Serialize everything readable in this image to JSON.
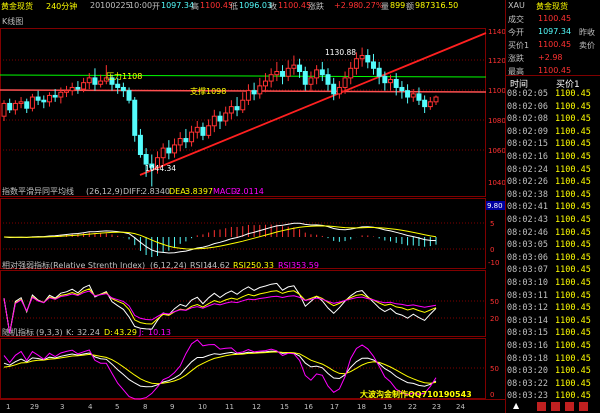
{
  "header": {
    "title": "黄金现货",
    "period": "240分钟",
    "date": "20100225",
    "time": "10:00",
    "open_label": "开",
    "open": "1097.34",
    "high_label": "高",
    "high": "1100.45",
    "low_label": "低",
    "low": "1096.03",
    "close_label": "收",
    "close": "1100.45",
    "change_label": "涨跌",
    "change": "+2.98",
    "pct": "0.27%",
    "vol_label": "量",
    "vol": "899",
    "amt_label": "额",
    "amt": "987316.50"
  },
  "main_chart": {
    "label": "K线图",
    "support_label": "支撑1098",
    "pressure_label": "压力1108",
    "high_note": "1130.88",
    "low_note": "1044.34",
    "y_ticks": [
      "1140",
      "1120",
      "1100",
      "1080",
      "1060",
      "1040"
    ]
  },
  "macd": {
    "name": "指数平滑异同平均线",
    "params": "(26,12,9)",
    "diff_label": "DIFF:",
    "diff": "2.8340",
    "dea_label": "DEA:",
    "dea": "3.8397",
    "macd_label": "MACD:",
    "macd": "-2.0114",
    "y_ticks": [
      "9.80",
      "5",
      "0",
      "-10"
    ]
  },
  "rsi": {
    "name": "相对强弱指标(Relative Strenth Index)",
    "params": "(6,12,24)",
    "rsi1_label": "RSI1:",
    "rsi1": "44.62",
    "rsi2_label": "RSI2:",
    "rsi2": "50.33",
    "rsi3_label": "RSI3:",
    "rsi3": "53.59",
    "y_ticks": [
      "50",
      "20"
    ]
  },
  "kdj": {
    "name": "随机指标",
    "params": "(9,3,3)",
    "k_label": "K:",
    "k": "32.24",
    "d_label": "D:",
    "d": "43.29",
    "j_label": "J:",
    "j": "10.13",
    "watermark": "大波沟金制作QQ710190543",
    "y_ticks": [
      "50",
      "0"
    ]
  },
  "x_axis": [
    "1",
    "29",
    "3",
    "4",
    "5",
    "8",
    "9",
    "10",
    "11",
    "12",
    "15",
    "16",
    "17",
    "18",
    "19",
    "22",
    "23",
    "24"
  ],
  "right_panel": {
    "symbol": "XAU",
    "name": "黄金现货",
    "quotes": [
      {
        "label": "成交",
        "value": "1100.45",
        "label2": "",
        "value2": ""
      },
      {
        "label": "今开",
        "value": "1097.34",
        "label2": "昨收",
        "value2": ""
      },
      {
        "label": "买价1",
        "value": "1100.45",
        "label2": "卖价",
        "value2": ""
      },
      {
        "label": "涨跌",
        "value": "+2.98",
        "label2": "",
        "value2": ""
      },
      {
        "label": "最高",
        "value": "1100.45",
        "label2": "",
        "value2": ""
      }
    ],
    "tick_header_time": "时间",
    "tick_header_price": "买价1",
    "ticks": [
      {
        "time": "08:02:05",
        "price": "1100.45"
      },
      {
        "time": "08:02:06",
        "price": "1100.45"
      },
      {
        "time": "08:02:08",
        "price": "1100.45"
      },
      {
        "time": "08:02:09",
        "price": "1100.45"
      },
      {
        "time": "08:02:15",
        "price": "1100.45"
      },
      {
        "time": "08:02:16",
        "price": "1100.45"
      },
      {
        "time": "08:02:24",
        "price": "1100.45"
      },
      {
        "time": "08:02:26",
        "price": "1100.45"
      },
      {
        "time": "08:02:38",
        "price": "1100.45"
      },
      {
        "time": "08:02:41",
        "price": "1100.45"
      },
      {
        "time": "08:02:43",
        "price": "1100.45"
      },
      {
        "time": "08:02:46",
        "price": "1100.45"
      },
      {
        "time": "08:03:05",
        "price": "1100.45"
      },
      {
        "time": "08:03:06",
        "price": "1100.45"
      },
      {
        "time": "08:03:07",
        "price": "1100.45"
      },
      {
        "time": "08:03:10",
        "price": "1100.45"
      },
      {
        "time": "08:03:11",
        "price": "1100.45"
      },
      {
        "time": "08:03:12",
        "price": "1100.45"
      },
      {
        "time": "08:03:14",
        "price": "1100.45"
      },
      {
        "time": "08:03:15",
        "price": "1100.45"
      },
      {
        "time": "08:03:16",
        "price": "1100.45"
      },
      {
        "time": "08:03:18",
        "price": "1100.45"
      },
      {
        "time": "08:03:20",
        "price": "1100.45"
      },
      {
        "time": "08:03:22",
        "price": "1100.45"
      },
      {
        "time": "08:03:23",
        "price": "1100.45"
      }
    ]
  },
  "colors": {
    "up": "#ff3232",
    "down": "#54fcfc",
    "ma_yellow": "#ffff00",
    "ma_purple": "#ff00ff",
    "support": "#ff5050",
    "pressure": "#00ff00",
    "grid": "#800000"
  },
  "candles": [
    [
      1088,
      1096,
      1085,
      1098
    ],
    [
      1096,
      1092,
      1090,
      1099
    ],
    [
      1092,
      1096,
      1089,
      1098
    ],
    [
      1096,
      1097,
      1093,
      1100
    ],
    [
      1097,
      1093,
      1090,
      1099
    ],
    [
      1093,
      1100,
      1091,
      1102
    ],
    [
      1100,
      1098,
      1095,
      1104
    ],
    [
      1098,
      1097,
      1093,
      1101
    ],
    [
      1097,
      1101,
      1094,
      1103
    ],
    [
      1101,
      1100,
      1097,
      1105
    ],
    [
      1100,
      1103,
      1096,
      1106
    ],
    [
      1103,
      1104,
      1100,
      1107
    ],
    [
      1104,
      1106,
      1101,
      1109
    ],
    [
      1106,
      1105,
      1102,
      1110
    ],
    [
      1105,
      1109,
      1103,
      1112
    ],
    [
      1109,
      1112,
      1105,
      1115
    ],
    [
      1112,
      1108,
      1104,
      1118
    ],
    [
      1108,
      1110,
      1106,
      1114
    ],
    [
      1110,
      1112,
      1108,
      1120
    ],
    [
      1112,
      1108,
      1104,
      1114
    ],
    [
      1108,
      1106,
      1102,
      1112
    ],
    [
      1106,
      1104,
      1100,
      1109
    ],
    [
      1104,
      1098,
      1096,
      1106
    ],
    [
      1098,
      1076,
      1072,
      1100
    ],
    [
      1076,
      1064,
      1062,
      1080
    ],
    [
      1064,
      1058,
      1050,
      1068
    ],
    [
      1058,
      1056,
      1044,
      1064
    ],
    [
      1056,
      1062,
      1052,
      1066
    ],
    [
      1062,
      1068,
      1058,
      1071
    ],
    [
      1068,
      1065,
      1061,
      1073
    ],
    [
      1065,
      1070,
      1062,
      1074
    ],
    [
      1070,
      1074,
      1066,
      1078
    ],
    [
      1074,
      1072,
      1068,
      1080
    ],
    [
      1072,
      1078,
      1069,
      1082
    ],
    [
      1078,
      1081,
      1074,
      1085
    ],
    [
      1081,
      1076,
      1073,
      1084
    ],
    [
      1076,
      1082,
      1074,
      1086
    ],
    [
      1082,
      1088,
      1078,
      1092
    ],
    [
      1088,
      1085,
      1080,
      1091
    ],
    [
      1085,
      1090,
      1082,
      1094
    ],
    [
      1090,
      1094,
      1086,
      1098
    ],
    [
      1094,
      1092,
      1088,
      1100
    ],
    [
      1092,
      1098,
      1090,
      1103
    ],
    [
      1098,
      1104,
      1095,
      1108
    ],
    [
      1104,
      1102,
      1098,
      1109
    ],
    [
      1102,
      1107,
      1099,
      1112
    ],
    [
      1107,
      1110,
      1103,
      1115
    ],
    [
      1110,
      1114,
      1106,
      1118
    ],
    [
      1114,
      1116,
      1110,
      1122
    ],
    [
      1116,
      1113,
      1108,
      1120
    ],
    [
      1113,
      1118,
      1110,
      1123
    ],
    [
      1118,
      1120,
      1114,
      1126
    ],
    [
      1120,
      1116,
      1112,
      1124
    ],
    [
      1116,
      1108,
      1104,
      1119
    ],
    [
      1108,
      1112,
      1104,
      1116
    ],
    [
      1112,
      1117,
      1108,
      1120
    ],
    [
      1117,
      1114,
      1110,
      1122
    ],
    [
      1114,
      1108,
      1104,
      1118
    ],
    [
      1108,
      1102,
      1098,
      1112
    ],
    [
      1102,
      1106,
      1099,
      1110
    ],
    [
      1106,
      1112,
      1102,
      1116
    ],
    [
      1112,
      1118,
      1108,
      1122
    ],
    [
      1118,
      1124,
      1114,
      1128
    ],
    [
      1124,
      1126,
      1119,
      1131
    ],
    [
      1126,
      1122,
      1118,
      1130
    ],
    [
      1122,
      1118,
      1114,
      1127
    ],
    [
      1118,
      1113,
      1108,
      1122
    ],
    [
      1113,
      1109,
      1104,
      1116
    ],
    [
      1109,
      1111,
      1104,
      1114
    ],
    [
      1111,
      1106,
      1101,
      1115
    ],
    [
      1106,
      1104,
      1099,
      1110
    ],
    [
      1104,
      1100,
      1096,
      1108
    ],
    [
      1100,
      1102,
      1097,
      1105
    ],
    [
      1102,
      1098,
      1095,
      1106
    ],
    [
      1098,
      1094,
      1090,
      1101
    ],
    [
      1094,
      1097,
      1092,
      1100
    ],
    [
      1097,
      1100,
      1095,
      1101
    ]
  ]
}
